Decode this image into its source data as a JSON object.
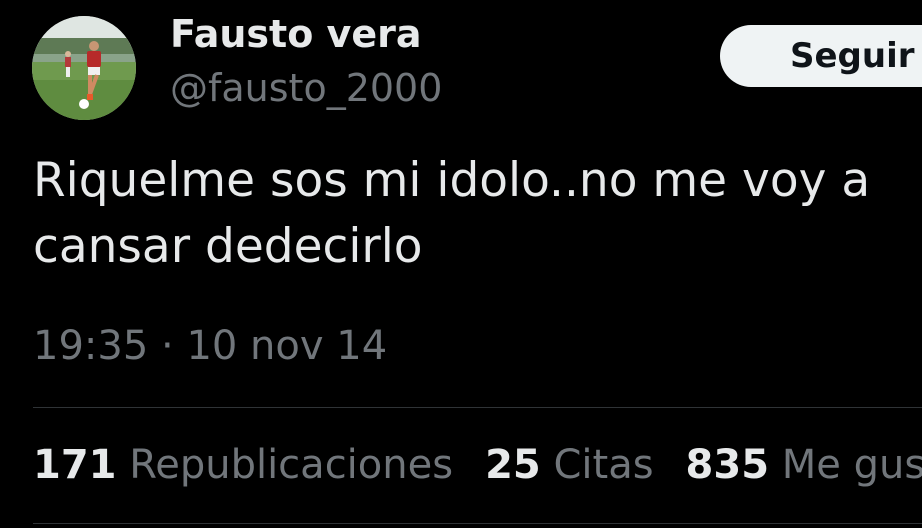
{
  "user": {
    "display_name": "Fausto vera",
    "handle": "@fausto_2000"
  },
  "follow_button": {
    "label": "Seguir"
  },
  "tweet": {
    "line1": "Riquelme sos mi idolo..no me voy a",
    "line2": "cansar dedecirlo"
  },
  "meta": {
    "time": "19:35",
    "separator": "·",
    "date": "10 nov 14"
  },
  "stats": {
    "reposts_count": "171",
    "reposts_label": "Republicaciones",
    "quotes_count": "25",
    "quotes_label": "Citas",
    "likes_count": "835",
    "likes_label": "Me gusta"
  },
  "colors": {
    "background": "#000000",
    "primary_text": "#e7e9ea",
    "secondary_text": "#71767b",
    "divider": "#2f3336",
    "button_bg": "#eff3f4"
  }
}
